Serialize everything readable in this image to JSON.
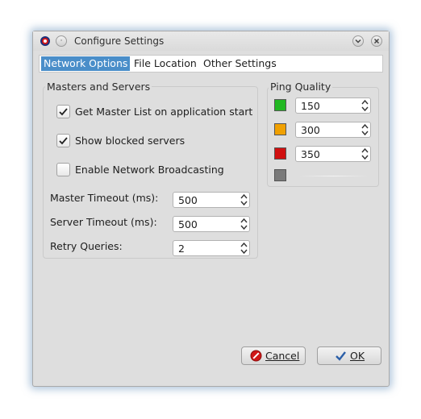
{
  "window": {
    "title": "Configure Settings"
  },
  "tabs": [
    {
      "label": "Network Options",
      "active": true
    },
    {
      "label": "File Location",
      "active": false
    },
    {
      "label": "Other Settings",
      "active": false
    }
  ],
  "masters": {
    "title": "Masters and Servers",
    "checkboxes": [
      {
        "label": "Get Master List on application start",
        "checked": true
      },
      {
        "label": "Show blocked servers",
        "checked": true
      },
      {
        "label": "Enable Network Broadcasting",
        "checked": false
      }
    ],
    "fields": [
      {
        "label": "Master Timeout (ms):",
        "value": "500"
      },
      {
        "label": "Server Timeout (ms):",
        "value": "500"
      },
      {
        "label": "Retry Queries:",
        "value": "2"
      }
    ]
  },
  "ping": {
    "title": "Ping Quality",
    "rows": [
      {
        "color": "#22b822",
        "value": "150"
      },
      {
        "color": "#f0a000",
        "value": "300"
      },
      {
        "color": "#d01010",
        "value": "350"
      },
      {
        "color": "#7a7a7a",
        "value": ""
      }
    ]
  },
  "buttons": {
    "cancel_label": "Cancel",
    "ok_label": "OK"
  }
}
